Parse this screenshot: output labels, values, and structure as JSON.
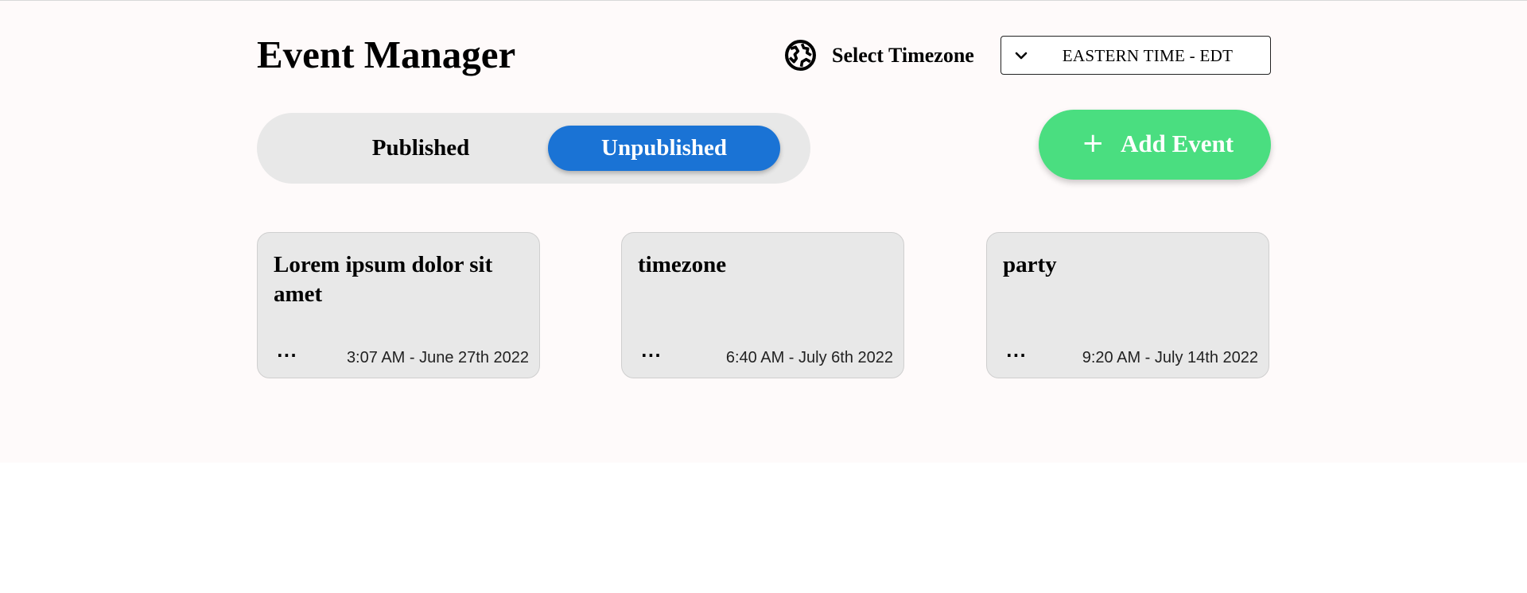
{
  "app_title": "Event Manager",
  "timezone": {
    "label": "Select Timezone",
    "selected": "EASTERN TIME - EDT",
    "icon": "globe-icon"
  },
  "tabs": {
    "published_label": "Published",
    "unpublished_label": "Unpublished",
    "active": "Unpublished"
  },
  "add_event": {
    "icon": "plus-icon",
    "plus_glyph": "+",
    "label": "Add Event"
  },
  "events": [
    {
      "title": "Lorem ipsum dolor sit amet",
      "menu_glyph": "...",
      "datetime": "3:07 AM - June 27th 2022"
    },
    {
      "title": "timezone",
      "menu_glyph": "...",
      "datetime": "6:40 AM - July 6th 2022"
    },
    {
      "title": "party",
      "menu_glyph": "...",
      "datetime": "9:20 AM - July 14th 2022"
    }
  ],
  "colors": {
    "active_tab": "#1a73d5",
    "add_button": "#4ade80",
    "background": "#fefafa",
    "card": "#e8e8e8"
  }
}
